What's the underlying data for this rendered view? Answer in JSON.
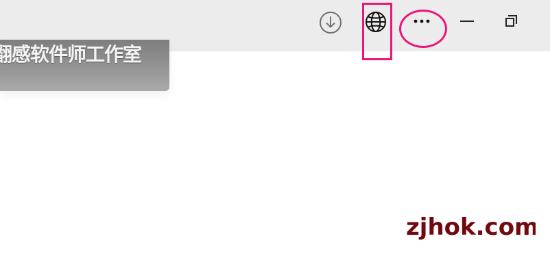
{
  "toolbar": {
    "buttons": [
      {
        "icon": "download-icon"
      },
      {
        "icon": "globe-icon"
      },
      {
        "icon": "more-icon"
      },
      {
        "icon": "minimize-icon"
      },
      {
        "icon": "restore-icon"
      }
    ]
  },
  "banner": {
    "text": "翻感软件师工作室"
  },
  "watermark": {
    "text": "zjhok.com"
  },
  "annotations": {
    "color": "#ec1678"
  },
  "colors": {
    "toolbar_bg": "#ececec",
    "watermark": "#73090f"
  }
}
